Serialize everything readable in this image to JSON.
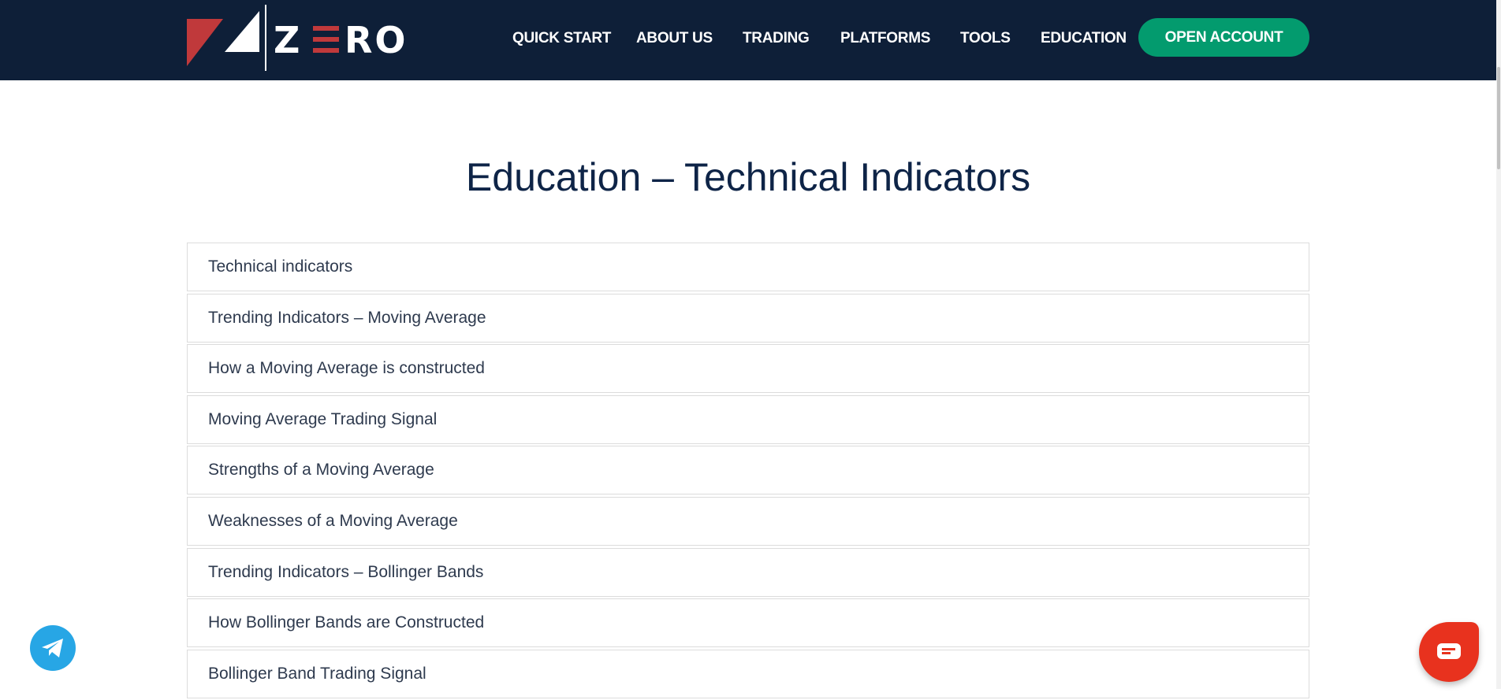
{
  "header": {
    "logo_text": "ZERO",
    "nav": [
      {
        "label": "QUICK START"
      },
      {
        "label": "ABOUT US"
      },
      {
        "label": "TRADING"
      },
      {
        "label": "PLATFORMS"
      },
      {
        "label": "TOOLS"
      },
      {
        "label": "EDUCATION"
      }
    ],
    "open_account_label": "OPEN ACCOUNT"
  },
  "main": {
    "title": "Education – Technical Indicators",
    "items": [
      {
        "label": "Technical indicators"
      },
      {
        "label": "Trending Indicators – Moving Average"
      },
      {
        "label": "How a Moving Average is constructed"
      },
      {
        "label": "Moving Average Trading Signal"
      },
      {
        "label": "Strengths of a Moving Average"
      },
      {
        "label": "Weaknesses of a Moving Average"
      },
      {
        "label": "Trending Indicators – Bollinger Bands"
      },
      {
        "label": "How Bollinger Bands are Constructed"
      },
      {
        "label": "Bollinger Band Trading Signal"
      }
    ]
  },
  "colors": {
    "header_bg": "#0e1f38",
    "accent_green": "#039b6e",
    "logo_red": "#c0393b",
    "telegram": "#27a6e5",
    "chat": "#e8321e"
  }
}
